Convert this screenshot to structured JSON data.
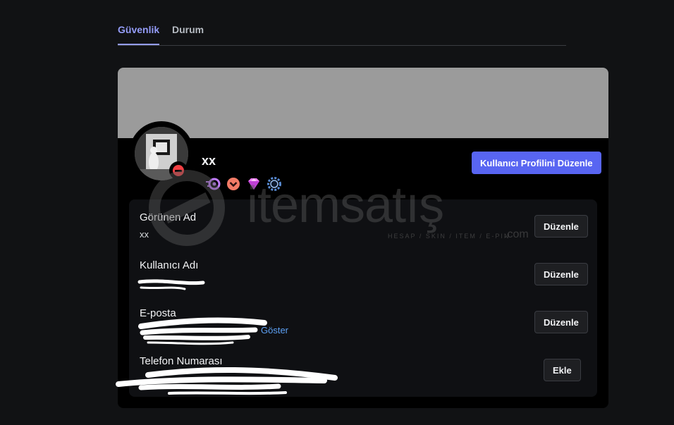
{
  "tabs": [
    {
      "label": "Güvenlik",
      "active": true
    },
    {
      "label": "Durum",
      "active": false
    }
  ],
  "profile": {
    "display_name": "xx",
    "edit_profile_label": "Kullanıcı Profilini Düzenle",
    "status": "do-not-disturb",
    "badges": [
      "nitro-badge",
      "boost-badge",
      "gem-badge",
      "laurel-badge"
    ]
  },
  "watermark": {
    "text": "itemsatış",
    "subtitle": "HESAP / SKIN / ITEM / E-PIN",
    "suffix": ".com"
  },
  "fields": [
    {
      "label": "Görünen Ad",
      "value": "xx",
      "button": "Düzenle"
    },
    {
      "label": "Kullanıcı Adı",
      "value": "",
      "button": "Düzenle"
    },
    {
      "label": "E-posta",
      "value": "",
      "show_label": "Göster",
      "button": "Düzenle"
    },
    {
      "label": "Telefon Numarası",
      "value": "",
      "button": "Ekle"
    }
  ],
  "colors": {
    "accent": "#5865f2",
    "tab_active": "#949cf7",
    "link": "#5da1f5",
    "dnd_status": "#f23f43",
    "banner": "#9b9b9b"
  }
}
